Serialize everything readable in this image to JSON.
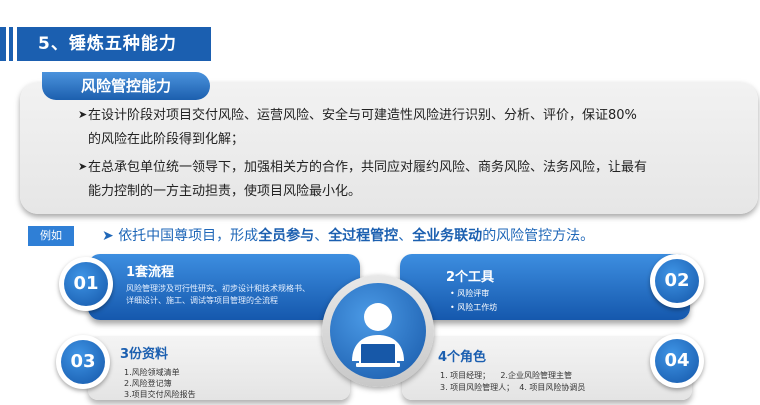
{
  "header": {
    "title": "5、锤炼五种能力"
  },
  "panel": {
    "tag": "风险管控能力",
    "p1_line1": "在设计阶段对项目交付风险、运营风险、安全与可建造性风险进行识别、分析、评价，保证80%",
    "p1_line2": "的风险在此阶段得到化解；",
    "p2_line1": "在总承包单位统一领导下，加强相关方的合作，共同应对履约风险、商务风险、法务风险，让最有",
    "p2_line2": "能力控制的一方主动担责，使项目风险最小化。",
    "bullet": "➤"
  },
  "example": {
    "tag": "例如",
    "arrow": "➤",
    "pre": "依托中国尊项目，形成",
    "b1": "全员参与",
    "sep1": "、",
    "b2": "全过程管控",
    "sep2": "、",
    "b3": "全业务联动",
    "post": "的风险管控方法。"
  },
  "cards": {
    "c1": {
      "num": "01",
      "title": "1套流程",
      "desc1": "风险管理涉及可行性研究、初步设计和技术规格书、",
      "desc2": "详细设计、施工、调试等项目管理的全流程"
    },
    "c2": {
      "num": "02",
      "title": "2个工具",
      "items": [
        "风险评审",
        "风险工作坊"
      ]
    },
    "c3": {
      "num": "03",
      "title": "3份资料",
      "items": [
        "1.风险领域清单",
        "2.风险登记簿",
        "3.项目交付风险报告"
      ]
    },
    "c4": {
      "num": "04",
      "title": "4个角色",
      "line1": "1. 项目经理；    2.企业风险管理主管",
      "line2": "3. 项目风险管理人；  4. 项目风险协调员"
    }
  },
  "colors": {
    "primary": "#1b5fb0",
    "accent": "#2f7fd6",
    "panel": "#ececec"
  },
  "icons": {
    "center": "user-at-laptop-icon"
  }
}
